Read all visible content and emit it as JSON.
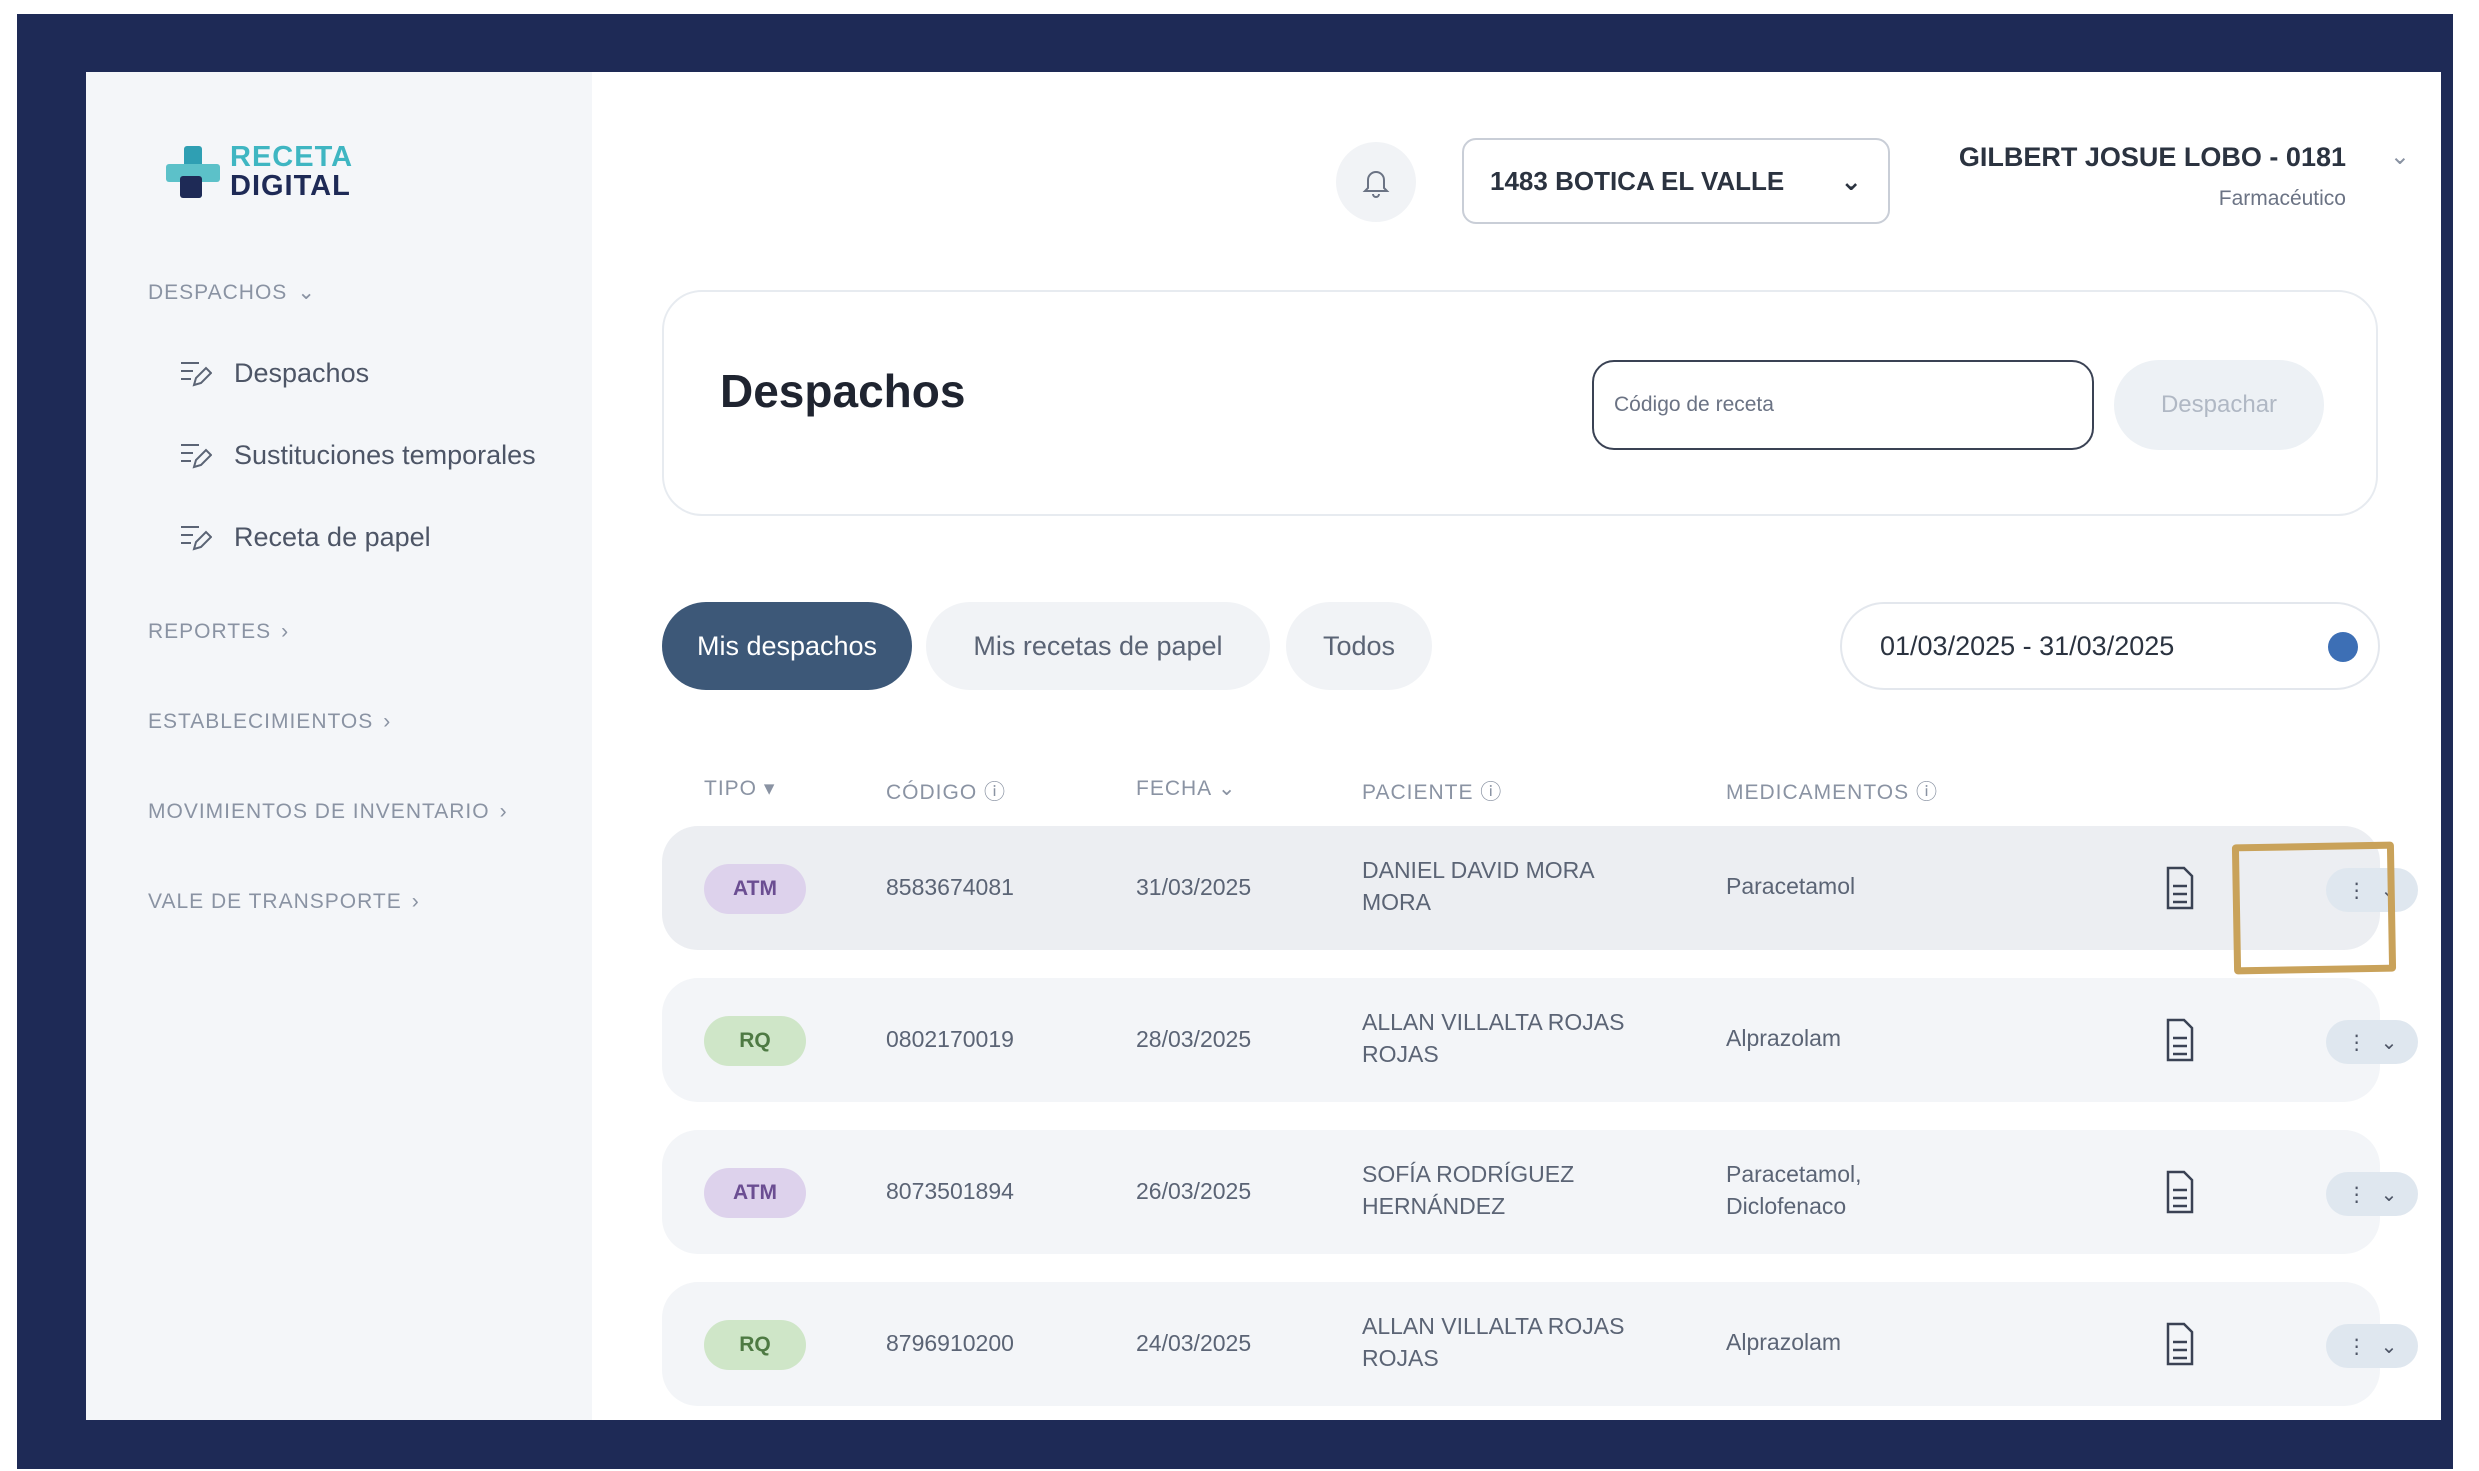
{
  "brand": {
    "line1": "RECETA",
    "line2": "DIGITAL"
  },
  "sidebar": {
    "section_despachos": "DESPACHOS",
    "items": [
      {
        "label": "Despachos"
      },
      {
        "label": "Sustituciones temporales"
      },
      {
        "label": "Receta de papel"
      }
    ],
    "section_reportes": "REPORTES",
    "section_establecimientos": "ESTABLECIMIENTOS",
    "section_movimientos": "MOVIMIENTOS DE INVENTARIO",
    "section_vale": "VALE DE TRANSPORTE"
  },
  "topbar": {
    "store": "1483 BOTICA EL VALLE",
    "user_name": "GILBERT JOSUE LOBO - 0181",
    "user_role": "Farmacéutico"
  },
  "header": {
    "title": "Despachos",
    "code_placeholder": "Código de receta",
    "dispatch_label": "Despachar"
  },
  "filters": {
    "tabs": [
      "Mis despachos",
      "Mis recetas de papel",
      "Todos"
    ],
    "date_range": "01/03/2025 - 31/03/2025"
  },
  "table": {
    "columns": [
      "TIPO",
      "CÓDIGO",
      "FECHA",
      "PACIENTE",
      "MEDICAMENTOS"
    ],
    "rows": [
      {
        "type": "ATM",
        "code": "8583674081",
        "date": "31/03/2025",
        "patient_l1": "DANIEL DAVID MORA",
        "patient_l2": "MORA",
        "meds_l1": "Paracetamol",
        "meds_l2": ""
      },
      {
        "type": "RQ",
        "code": "0802170019",
        "date": "28/03/2025",
        "patient_l1": "ALLAN VILLALTA ROJAS",
        "patient_l2": "ROJAS",
        "meds_l1": "Alprazolam",
        "meds_l2": ""
      },
      {
        "type": "ATM",
        "code": "8073501894",
        "date": "26/03/2025",
        "patient_l1": "SOFÍA RODRÍGUEZ",
        "patient_l2": "HERNÁNDEZ",
        "meds_l1": "Paracetamol,",
        "meds_l2": "Diclofenaco"
      },
      {
        "type": "RQ",
        "code": "8796910200",
        "date": "24/03/2025",
        "patient_l1": "ALLAN VILLALTA ROJAS",
        "patient_l2": "ROJAS",
        "meds_l1": "Alprazolam",
        "meds_l2": ""
      }
    ]
  },
  "colors": {
    "frame": "#1e2a56",
    "active_tab": "#3d5878",
    "badge_atm": "#ddd2ec",
    "badge_rq": "#cfe6c8",
    "highlight": "#c9a25a"
  }
}
